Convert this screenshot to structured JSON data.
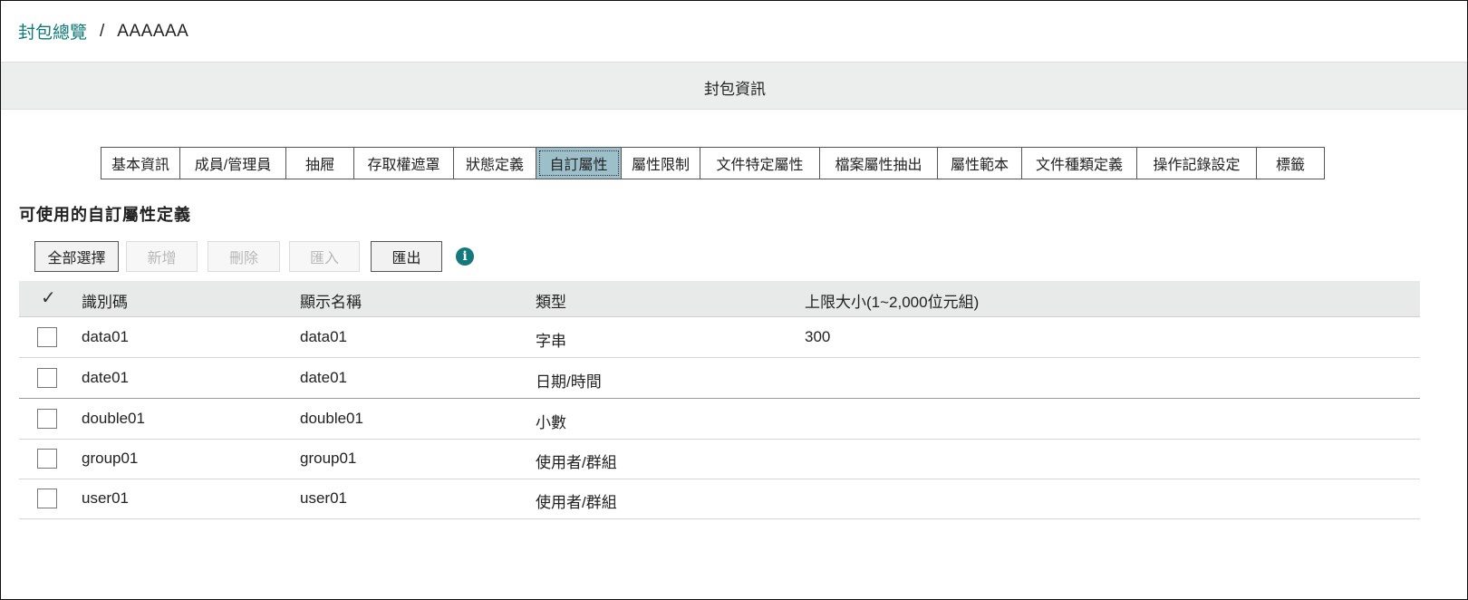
{
  "breadcrumb": {
    "root": "封包總覽",
    "separator": "/",
    "current": "AAAAAA"
  },
  "section": {
    "title": "封包資訊"
  },
  "tabs": [
    {
      "label": "基本資訊",
      "active": false
    },
    {
      "label": "成員/管理員",
      "active": false
    },
    {
      "label": "抽屜",
      "active": false
    },
    {
      "label": "存取權遮罩",
      "active": false
    },
    {
      "label": "狀態定義",
      "active": false
    },
    {
      "label": "自訂屬性",
      "active": true
    },
    {
      "label": "屬性限制",
      "active": false
    },
    {
      "label": "文件特定屬性",
      "active": false
    },
    {
      "label": "檔案屬性抽出",
      "active": false
    },
    {
      "label": "屬性範本",
      "active": false
    },
    {
      "label": "文件種類定義",
      "active": false
    },
    {
      "label": "操作記錄設定",
      "active": false
    },
    {
      "label": "標籤",
      "active": false
    }
  ],
  "subtitle": "可使用的自訂屬性定義",
  "toolbar": {
    "select_all": "全部選擇",
    "add": "新增",
    "delete": "刪除",
    "import": "匯入",
    "export": "匯出",
    "info_icon": "info-icon"
  },
  "table": {
    "check_mark": "✓",
    "columns": [
      "識別碼",
      "顯示名稱",
      "類型",
      "上限大小(1~2,000位元組)"
    ],
    "rows": [
      {
        "id": "data01",
        "name": "data01",
        "type": "字串",
        "max": "300"
      },
      {
        "id": "date01",
        "name": "date01",
        "type": "日期/時間",
        "max": ""
      },
      {
        "id": "double01",
        "name": "double01",
        "type": "小數",
        "max": ""
      },
      {
        "id": "group01",
        "name": "group01",
        "type": "使用者/群組",
        "max": ""
      },
      {
        "id": "user01",
        "name": "user01",
        "type": "使用者/群組",
        "max": ""
      }
    ]
  },
  "colors": {
    "accent": "#0f7a7a",
    "active_tab": "#9dbfc9",
    "header_bg": "#e8eaea"
  }
}
